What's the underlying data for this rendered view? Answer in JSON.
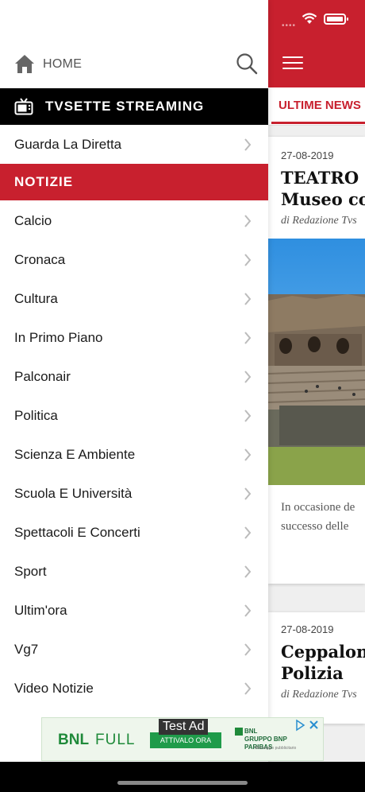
{
  "drawer": {
    "home_label": "HOME",
    "streaming_section": "TVSETTE STREAMING",
    "streaming_items": [
      {
        "label": "Guarda La Diretta"
      }
    ],
    "news_section": "NOTIZIE",
    "news_items": [
      {
        "label": "Calcio"
      },
      {
        "label": "Cronaca"
      },
      {
        "label": "Cultura"
      },
      {
        "label": "In Primo Piano"
      },
      {
        "label": "Palconair"
      },
      {
        "label": "Politica"
      },
      {
        "label": "Scienza E Ambiente"
      },
      {
        "label": "Scuola E Università"
      },
      {
        "label": "Spettacoli E Concerti"
      },
      {
        "label": "Sport"
      },
      {
        "label": "Ultim'ora"
      },
      {
        "label": "Vg7"
      },
      {
        "label": "Video Notizie"
      }
    ]
  },
  "app": {
    "active_tab": "ULTIME NEWS",
    "articles": [
      {
        "date": "27-08-2019",
        "title": "TEATRO l\nMuseo co",
        "author": "di Redazione Tvs",
        "excerpt": "In occasione de\nsuccesso delle"
      },
      {
        "date": "27-08-2019",
        "title": "Ceppalon\nPolizia",
        "author": "di Redazione Tvs"
      }
    ]
  },
  "ad": {
    "label": "Test Ad",
    "brand": "BNL",
    "product": "FULL",
    "cta": "ATTIVALO ORA",
    "bank_line1": "BNL",
    "bank_line2": "GRUPPO BNP PARIBAS",
    "note": "Messaggio pubblicitario"
  },
  "colors": {
    "brand_red": "#c8202e",
    "section_black": "#000000",
    "ad_green": "#1f8a3a"
  }
}
